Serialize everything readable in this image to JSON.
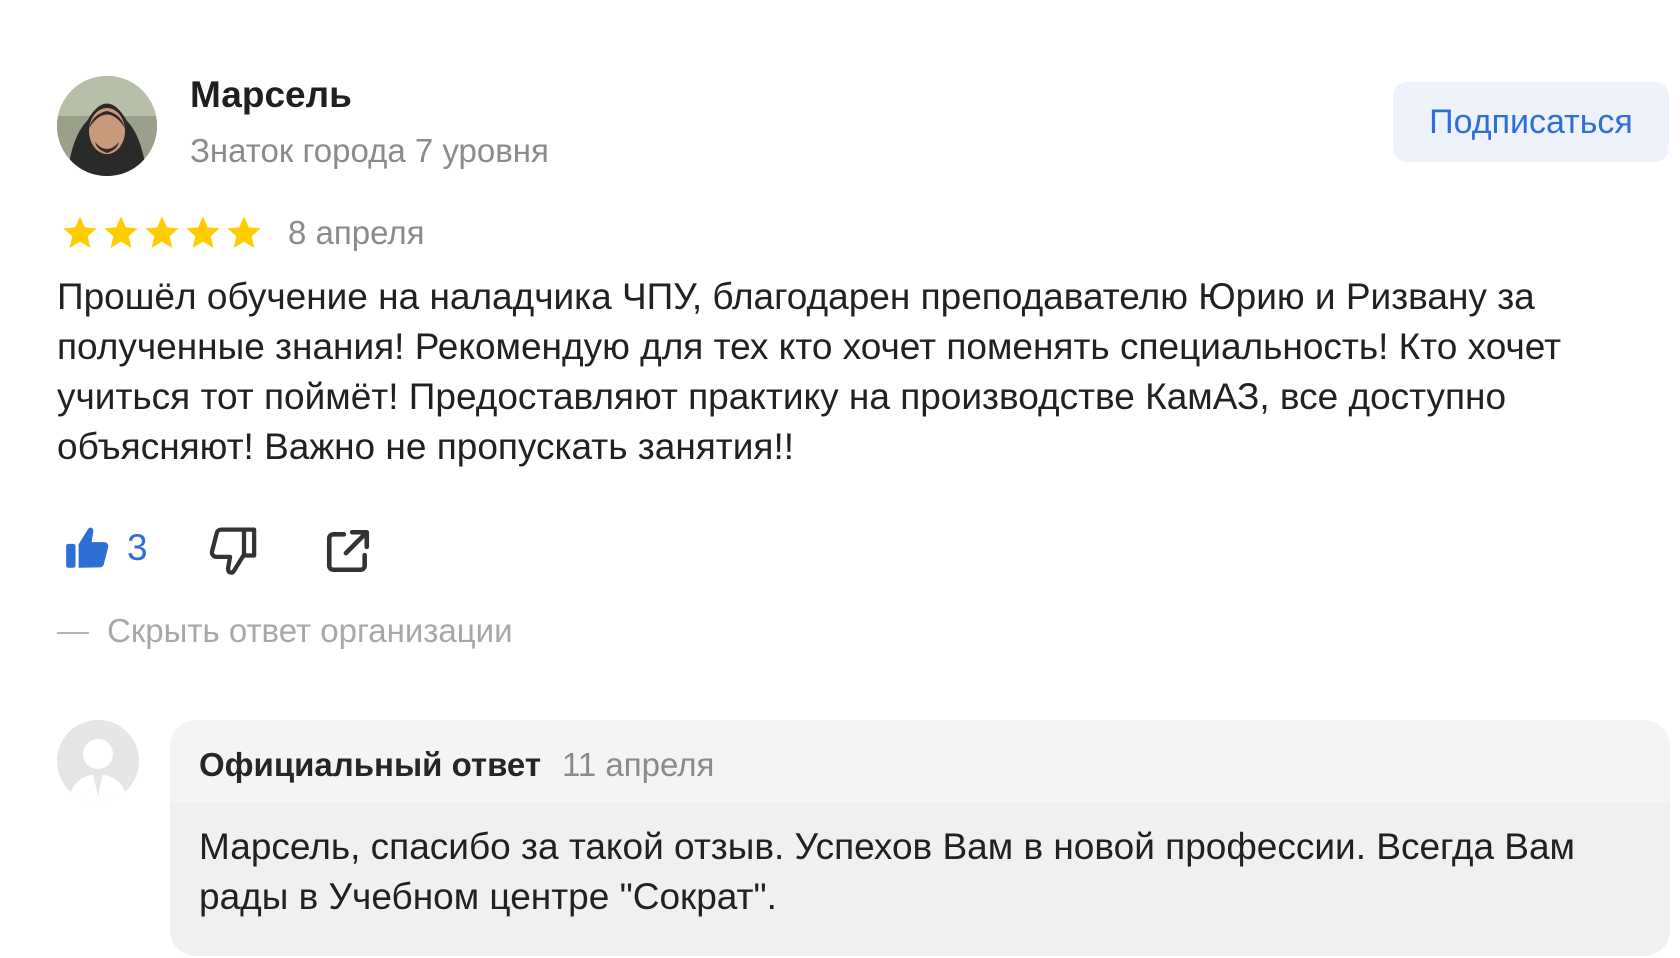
{
  "author": {
    "name": "Марсель",
    "level": "Знаток города 7 уровня",
    "avatar_icon": "user-photo"
  },
  "subscribe_label": "Подписаться",
  "review": {
    "rating": 5,
    "rating_max": 5,
    "date": "8 апреля",
    "text": "Прошёл обучение на наладчика ЧПУ, благодарен преподавателю Юрию и Ризвану за полученные знания! Рекомендую для тех кто хочет поменять специальность! Кто хочет учиться тот поймёт! Предоставляют практику на производстве КамАЗ, все доступно объясняют! Важно не пропускать занятия!!"
  },
  "actions": {
    "like_count": "3",
    "like_icon": "thumbs-up-icon",
    "dislike_icon": "thumbs-down-icon",
    "share_icon": "share-icon"
  },
  "toggle_reply_label": "Скрыть ответ организации",
  "org_reply": {
    "label": "Официальный ответ",
    "date": "11 апреля",
    "text": "Марсель, спасибо за такой отзыв. Успехов Вам в новой профессии. Всегда Вам рады в Учебном центре \"Сократ\"."
  },
  "colors": {
    "accent": "#2e6fd6",
    "star": "#ffcc00",
    "muted_text": "#8b8b8b",
    "button_bg": "#eef3fb",
    "reply_bg": "#f4f4f4"
  }
}
